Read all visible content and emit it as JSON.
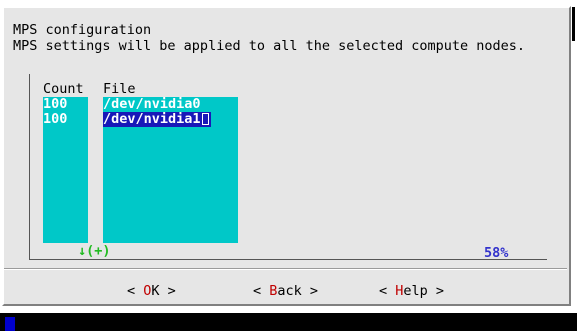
{
  "dialog": {
    "title": "MPS configuration",
    "description": "MPS settings will be applied to all the selected compute nodes."
  },
  "table": {
    "headers": {
      "count": "Count",
      "file": "File"
    },
    "rows": [
      {
        "count": "100",
        "file": "/dev/nvidia0"
      },
      {
        "count": "100",
        "file": "/dev/nvidia1"
      }
    ]
  },
  "status": {
    "scroll_indicator": "↓(+)",
    "percent": "58%"
  },
  "buttons": {
    "ok": {
      "left": "< ",
      "hot": "O",
      "rest": "K",
      "right": " >"
    },
    "back": {
      "left": "< ",
      "hot": "B",
      "rest": "ack",
      "right": " >"
    },
    "help": {
      "left": "< ",
      "hot": "H",
      "rest": "elp",
      "right": " >"
    }
  },
  "colors": {
    "dialog_bg": "#e6e6e6",
    "column_bg": "#00c8c8",
    "selection_bg": "#1818b8",
    "hotkey": "#c00000",
    "scroll_indicator": "#22bb22",
    "percent": "#3333cc"
  }
}
